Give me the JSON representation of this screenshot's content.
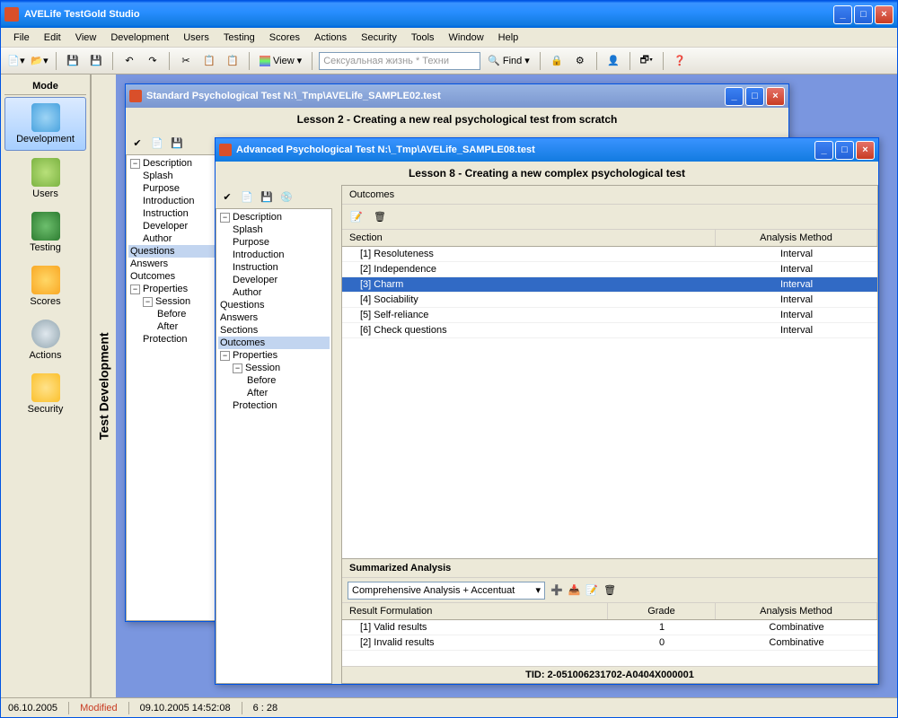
{
  "app": {
    "title": "AVELife TestGold Studio"
  },
  "menu": [
    "File",
    "Edit",
    "View",
    "Development",
    "Users",
    "Testing",
    "Scores",
    "Actions",
    "Security",
    "Tools",
    "Window",
    "Help"
  ],
  "toolbar": {
    "view_label": "View",
    "search_placeholder": "Сексуальная жизнь * Техни",
    "find_label": "Find"
  },
  "mode": {
    "title": "Mode",
    "items": [
      {
        "label": "Development",
        "selected": true
      },
      {
        "label": "Users"
      },
      {
        "label": "Testing"
      },
      {
        "label": "Scores"
      },
      {
        "label": "Actions"
      },
      {
        "label": "Security"
      }
    ],
    "vertical_label": "Test Development"
  },
  "window1": {
    "title": "Standard Psychological Test N:\\_Tmp\\AVELife_SAMPLE02.test",
    "lesson": "Lesson 2 - Creating a new real psychological test from scratch",
    "tree": [
      "Description",
      "Splash",
      "Purpose",
      "Introduction",
      "Instruction",
      "Developer",
      "Author",
      "Questions",
      "Answers",
      "Outcomes",
      "Properties",
      "Session",
      "Before",
      "After",
      "Protection"
    ]
  },
  "window2": {
    "title": "Advanced Psychological Test N:\\_Tmp\\AVELife_SAMPLE08.test",
    "lesson": "Lesson 8 - Creating a new complex psychological test",
    "tree": {
      "Description": [
        "Splash",
        "Purpose",
        "Introduction",
        "Instruction",
        "Developer",
        "Author"
      ],
      "flat": [
        "Questions",
        "Answers",
        "Sections",
        "Outcomes"
      ],
      "Properties": {
        "Session": [
          "Before",
          "After"
        ],
        "flat": [
          "Protection"
        ]
      }
    },
    "tree_selected": "Outcomes",
    "outcomes_label": "Outcomes",
    "grid": {
      "columns": [
        "Section",
        "Analysis Method"
      ],
      "rows": [
        {
          "section": "[1] Resoluteness",
          "method": "Interval"
        },
        {
          "section": "[2] Independence",
          "method": "Interval"
        },
        {
          "section": "[3] Charm",
          "method": "Interval",
          "selected": true
        },
        {
          "section": "[4] Sociability",
          "method": "Interval"
        },
        {
          "section": "[5] Self-reliance",
          "method": "Interval"
        },
        {
          "section": "[6] Check questions",
          "method": "Interval"
        }
      ]
    },
    "summary": {
      "title": "Summarized Analysis",
      "combo": "Comprehensive Analysis + Accentuat",
      "columns": [
        "Result Formulation",
        "Grade",
        "Analysis Method"
      ],
      "rows": [
        {
          "formulation": "[1] Valid results",
          "grade": "1",
          "method": "Combinative"
        },
        {
          "formulation": "[2] Invalid results",
          "grade": "0",
          "method": "Combinative"
        }
      ]
    },
    "tid": "TID: 2-051006231702-A0404X000001"
  },
  "statusbar": {
    "date1": "06.10.2005",
    "modified": "Modified",
    "datetime": "09.10.2005 14:52:08",
    "extra": "6 : 28"
  },
  "icon_colors": {
    "dev": "#4aa3df",
    "users": "#7cb342",
    "testing": "#2e7d32",
    "scores": "#f9a825",
    "actions": "#90a4ae",
    "security": "#fbc02d"
  }
}
